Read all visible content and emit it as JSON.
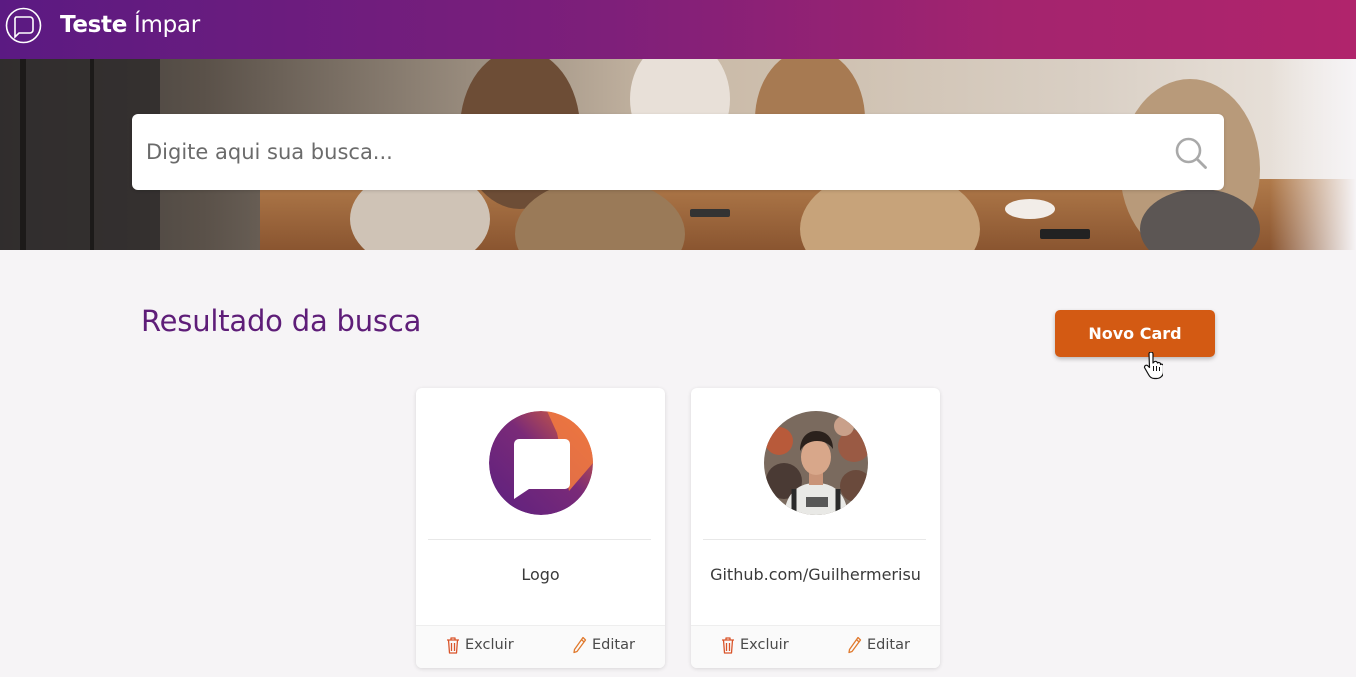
{
  "header": {
    "brand_bold": "Teste",
    "brand_light": "Ímpar",
    "gradient_start": "#5b1a82",
    "gradient_end": "#b0246c"
  },
  "search": {
    "placeholder": "Digite aqui sua busca...",
    "value": ""
  },
  "results": {
    "title": "Resultado da busca",
    "new_card_label": "Novo Card",
    "accent": "#d35a13"
  },
  "cards": [
    {
      "name": "Logo",
      "avatar": "logo-icon",
      "delete_label": "Excluir",
      "edit_label": "Editar"
    },
    {
      "name": "Github.com/Guilhermerisu",
      "avatar": "user-photo",
      "delete_label": "Excluir",
      "edit_label": "Editar"
    }
  ]
}
